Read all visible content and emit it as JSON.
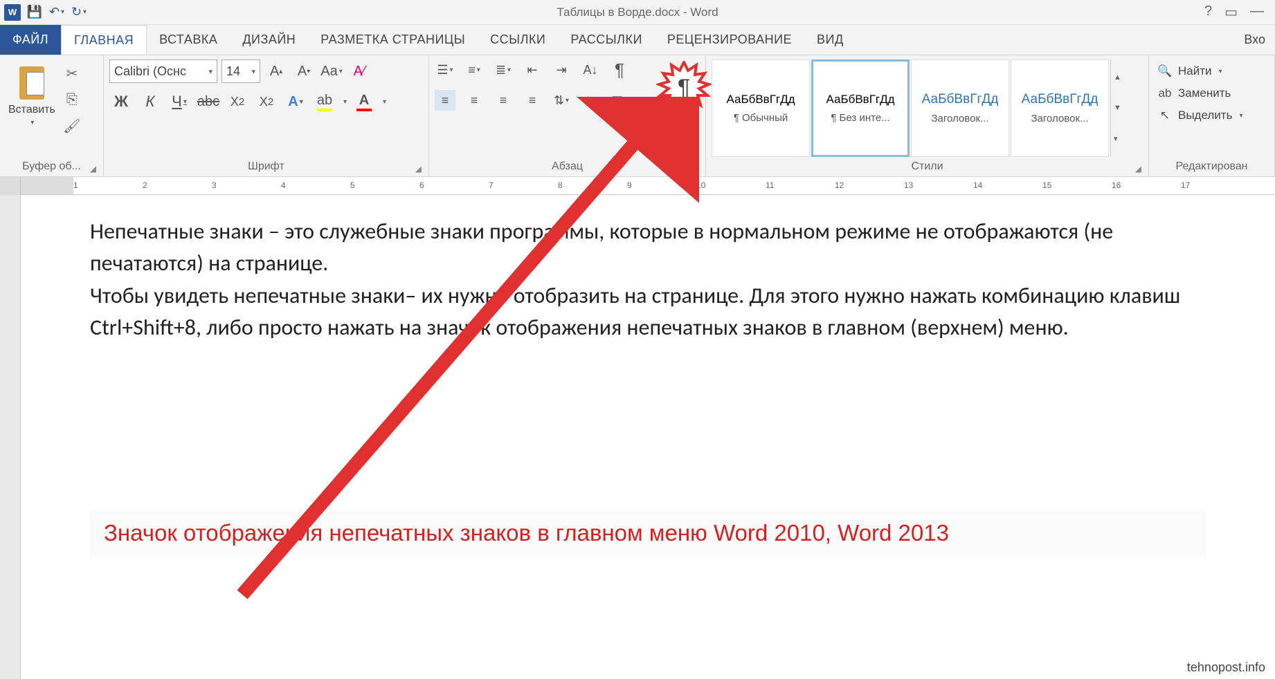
{
  "title": "Таблицы в Ворде.docx - Word",
  "qat": {
    "save": "save",
    "undo": "undo",
    "redo": "redo"
  },
  "tabs": {
    "file": "ФАЙЛ",
    "home": "ГЛАВНАЯ",
    "insert": "ВСТАВКА",
    "design": "ДИЗАЙН",
    "layout": "РАЗМЕТКА СТРАНИЦЫ",
    "references": "ССЫЛКИ",
    "mailings": "РАССЫЛКИ",
    "review": "РЕЦЕНЗИРОВАНИЕ",
    "view": "ВИД",
    "signin": "Вхо"
  },
  "clipboard": {
    "paste": "Вставить",
    "label": "Буфер об..."
  },
  "font": {
    "name": "Calibri (Оснс",
    "size": "14",
    "label": "Шрифт"
  },
  "paragraph": {
    "label": "Абзац"
  },
  "styles": {
    "label": "Стили",
    "preview": "АаБбВвГгДд",
    "items": [
      {
        "name": "¶ Обычный",
        "heading": false
      },
      {
        "name": "¶ Без инте...",
        "heading": false
      },
      {
        "name": "Заголовок...",
        "heading": true
      },
      {
        "name": "Заголовок...",
        "heading": true
      }
    ]
  },
  "editing": {
    "find": "Найти",
    "replace": "Заменить",
    "select": "Выделить",
    "label": "Редактирован"
  },
  "ruler": [
    "1",
    "2",
    "3",
    "4",
    "5",
    "6",
    "7",
    "8",
    "9",
    "10",
    "11",
    "12",
    "13",
    "14",
    "15",
    "16",
    "17"
  ],
  "document": {
    "p1": "Непечатные знаки – это служебные знаки программы, которые в нормальном режиме не отображаются (не печатаются) на странице.",
    "p2": "Чтобы увидеть непечатные знаки– их нужно отобразить на странице. Для этого нужно нажать комбинацию клавиш Ctrl+Shift+8, либо просто нажать на значок отображения непечатных знаков в главном (верхнем) меню."
  },
  "caption": "Значок отображения непечатных знаков в главном меню Word 2010, Word   2013",
  "watermark": "tehnopost.info"
}
